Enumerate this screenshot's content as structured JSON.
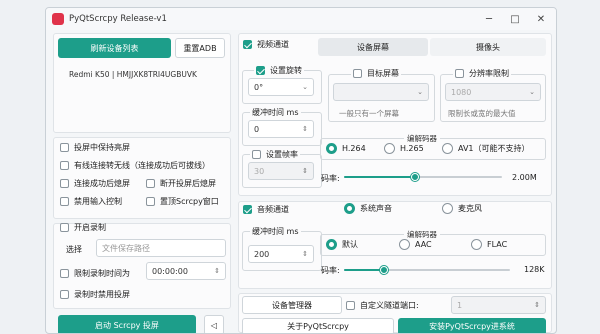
{
  "window": {
    "title": "PyQtScrcpy Release-v1",
    "minimize": "─",
    "maximize": "□",
    "close": "✕"
  },
  "devices": {
    "refresh_label": "刷新设备列表",
    "reset_adb_label": "重置ADB",
    "items": [
      "Redmi K50 | HMJJXK8TRI4UGBUVK"
    ]
  },
  "options": {
    "keep_awake": "投屏中保持亮屏",
    "wireless_after_connect": "有线连接转无线（连接成功后可拔线）",
    "screen_off_on_connect": "连接成功后熄屏",
    "screen_off_on_disconnect": "断开投屏后熄屏",
    "disable_input": "禁用输入控制",
    "always_on_top": "置顶Scrcpy窗口"
  },
  "record": {
    "enable_label": "开启录制",
    "choose_label": "选择",
    "path_placeholder": "文件保存路径",
    "limit_label": "限制录制时间为",
    "limit_value": "00:00:00",
    "disable_screen_label": "录制时禁用投屏"
  },
  "start": {
    "start_label": "启动 Scrcpy 投屏",
    "back_icon": "◁"
  },
  "video": {
    "enable_label": "视频通道",
    "tabs": [
      "设备屏幕",
      "摄像头"
    ],
    "rotation_label": "设置旋转",
    "rotation_value": "0°",
    "target_screen_label": "目标屏幕",
    "target_screen_hint": "一般只有一个屏幕",
    "resolution_label": "分辨率限制",
    "resolution_value": "1080",
    "resolution_hint": "限制长或宽的最大值",
    "buffer_label": "缓冲时间 ms",
    "buffer_value": "0",
    "fps_label": "设置帧率",
    "fps_value": "30",
    "codec_title": "编解码器",
    "codecs": [
      "H.264",
      "H.265",
      "AV1（可能不支持）"
    ],
    "bitrate_label": "码率:",
    "bitrate_value": "2.00M",
    "bitrate_fraction": 0.45
  },
  "audio": {
    "enable_label": "音频通道",
    "sources": [
      "系统声音",
      "麦克风"
    ],
    "buffer_label": "缓冲时间 ms",
    "buffer_value": "200",
    "codec_title": "编解码器",
    "codecs": [
      "默认",
      "AAC",
      "FLAC"
    ],
    "bitrate_label": "码率:",
    "bitrate_value": "128K",
    "bitrate_fraction": 0.24
  },
  "tools": {
    "device_manager_label": "设备管理器",
    "custom_tunnel_label": "自定义隧道端口:",
    "tunnel_value": "1",
    "about_label": "关于PyQtScrcpy",
    "install_label": "安装PyQtScrcpy进系统"
  },
  "colors": {
    "accent": "#1d9e8a",
    "brand": "#e0334a"
  }
}
